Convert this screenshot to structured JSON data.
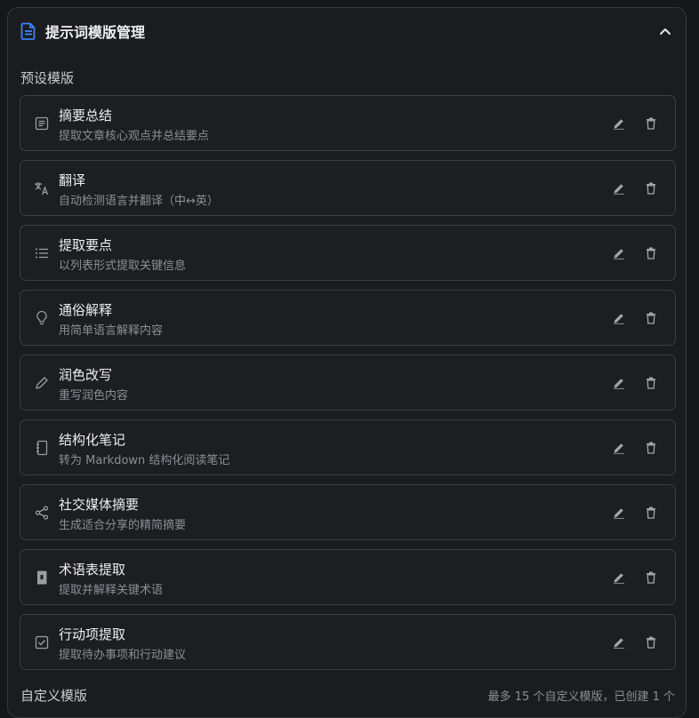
{
  "header": {
    "title": "提示词模版管理",
    "icon": "document-icon",
    "collapse_icon": "chevron-up-icon"
  },
  "presets": {
    "section_title": "预设模版",
    "items": [
      {
        "name": "摘要总结",
        "desc": "提取文章核心观点并总结要点",
        "icon": "article-icon"
      },
      {
        "name": "翻译",
        "desc": "自动检测语言并翻译（中↔英）",
        "icon": "translate-icon"
      },
      {
        "name": "提取要点",
        "desc": "以列表形式提取关键信息",
        "icon": "list-icon"
      },
      {
        "name": "通俗解释",
        "desc": "用简单语言解释内容",
        "icon": "lightbulb-icon"
      },
      {
        "name": "润色改写",
        "desc": "重写润色内容",
        "icon": "pencil-icon"
      },
      {
        "name": "结构化笔记",
        "desc": "转为 Markdown 结构化阅读笔记",
        "icon": "notebook-icon"
      },
      {
        "name": "社交媒体摘要",
        "desc": "生成适合分享的精简摘要",
        "icon": "share-icon"
      },
      {
        "name": "术语表提取",
        "desc": "提取并解释关键术语",
        "icon": "glossary-icon"
      },
      {
        "name": "行动项提取",
        "desc": "提取待办事项和行动建议",
        "icon": "checkbox-icon"
      }
    ]
  },
  "custom": {
    "section_title": "自定义模版",
    "note": "最多 15 个自定义模版，已创建 1 个"
  },
  "colors": {
    "accent": "#3b82f6",
    "background": "#1a1c1f",
    "border": "#3a3d42"
  }
}
